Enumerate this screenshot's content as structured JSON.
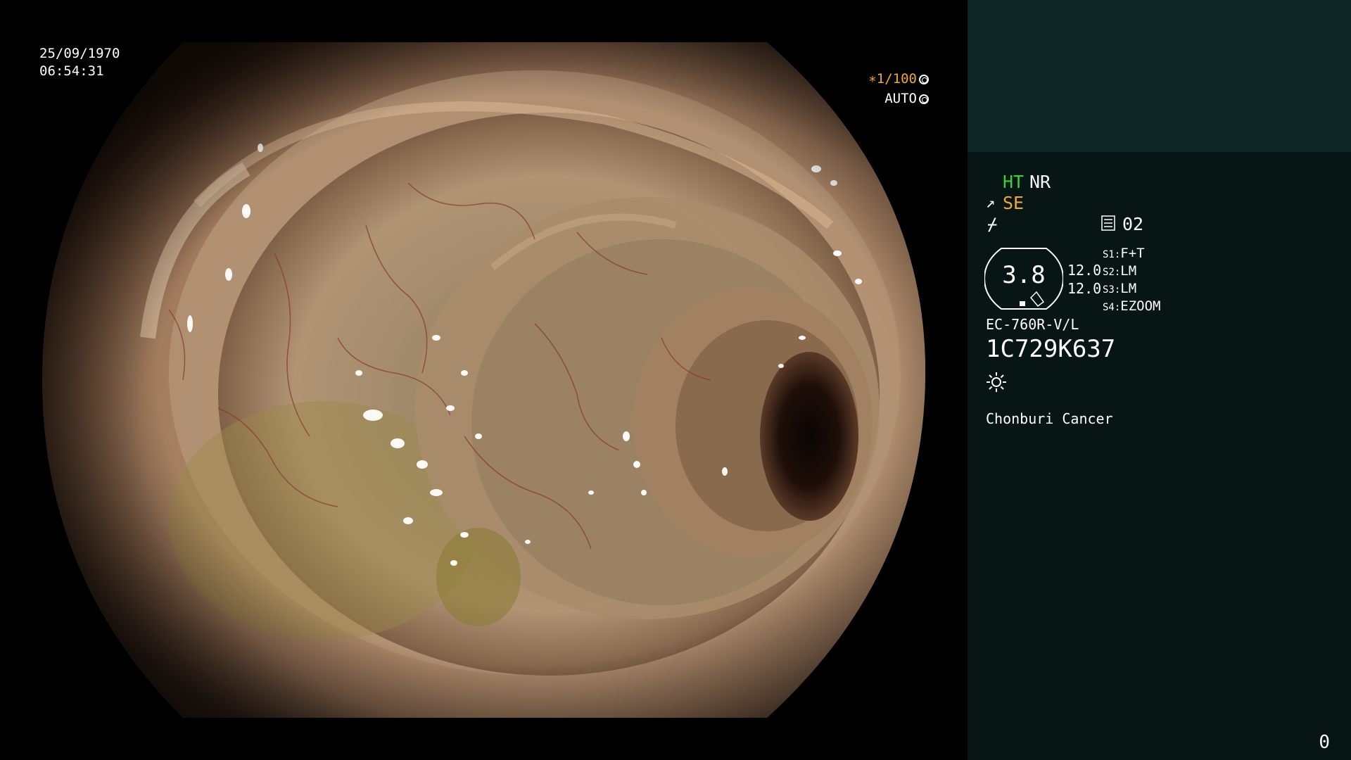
{
  "overlay": {
    "date": "25/09/1970",
    "time": "06:54:31",
    "shutter_value": "∗1/100",
    "iris_mode": "AUTO",
    "shutter_icon": "aperture-icon",
    "iris_icon": "iris-icon"
  },
  "panel": {
    "ht": "HT",
    "nr": "NR",
    "se": "SE",
    "se_icon": "structure-enhance-icon",
    "slash_icon": "color-mode-icon",
    "memory_icon": "memory-icon",
    "memory_value": "02",
    "zoom_value": "3.8",
    "right_values": [
      "12.0",
      "12.0"
    ],
    "switches": [
      {
        "key": "S1:",
        "value": "F+T"
      },
      {
        "key": "S2:",
        "value": "LM"
      },
      {
        "key": "S3:",
        "value": "LM"
      },
      {
        "key": "S4:",
        "value": "EZOOM"
      }
    ],
    "scope_model": "EC-760R-V/L",
    "serial": "1C729K637",
    "light_icon": "light-icon",
    "hospital": "Chonburi Cancer",
    "counter": "0"
  },
  "colors": {
    "accent_orange": "#f0a830",
    "accent_green": "#3ad23a",
    "panel_bg": "#071614",
    "panel_top_bg": "#0e2625"
  }
}
